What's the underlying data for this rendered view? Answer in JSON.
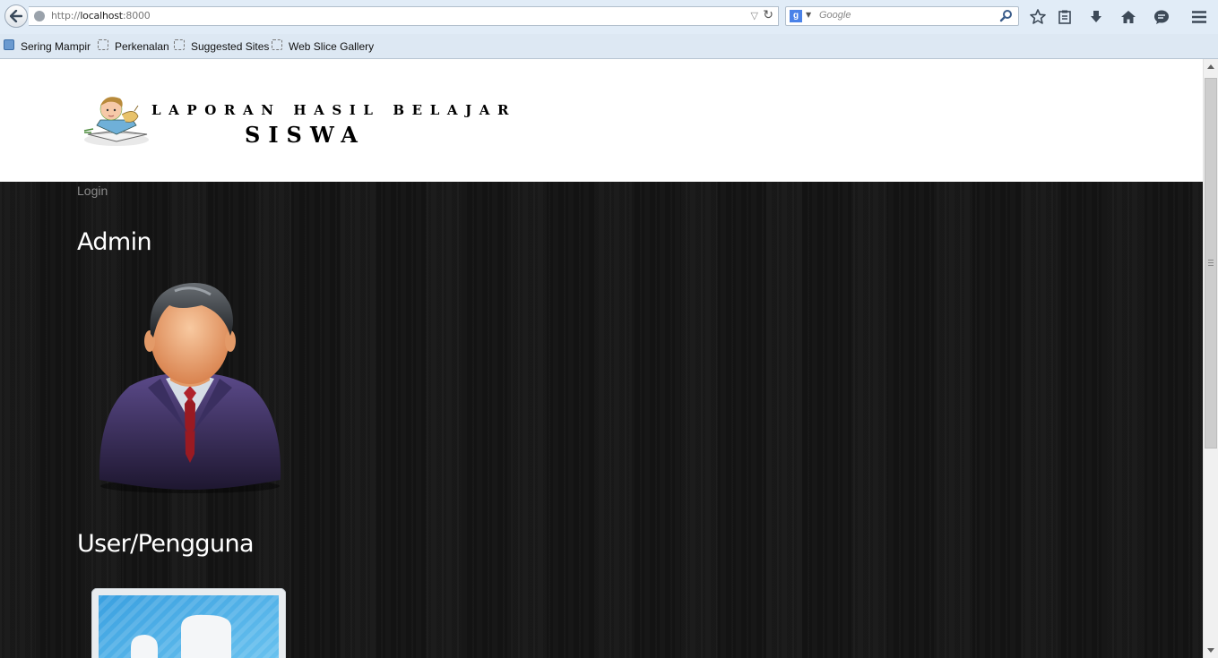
{
  "browser": {
    "url_prefix": "http://",
    "url_host": "localhost",
    "url_port": ":8000",
    "search_placeholder": "Google",
    "bookmarks": [
      "Sering Mampir",
      "Perkenalan",
      "Suggested Sites",
      "Web Slice Gallery"
    ]
  },
  "header": {
    "title_line1": "LAPORAN HASIL BELAJAR",
    "title_line2": "SISWA"
  },
  "nav": {
    "login": "Login"
  },
  "sections": {
    "admin_title": "Admin",
    "user_title": "User/Pengguna"
  },
  "icons": {
    "back": "back-arrow-icon",
    "reload": "reload-icon",
    "search": "magnifier-icon",
    "bookmark_star": "star-icon",
    "reading_list": "clipboard-icon",
    "downloads": "download-arrow-icon",
    "home": "home-icon",
    "chat": "chat-bubble-icon",
    "menu": "hamburger-menu-icon"
  }
}
